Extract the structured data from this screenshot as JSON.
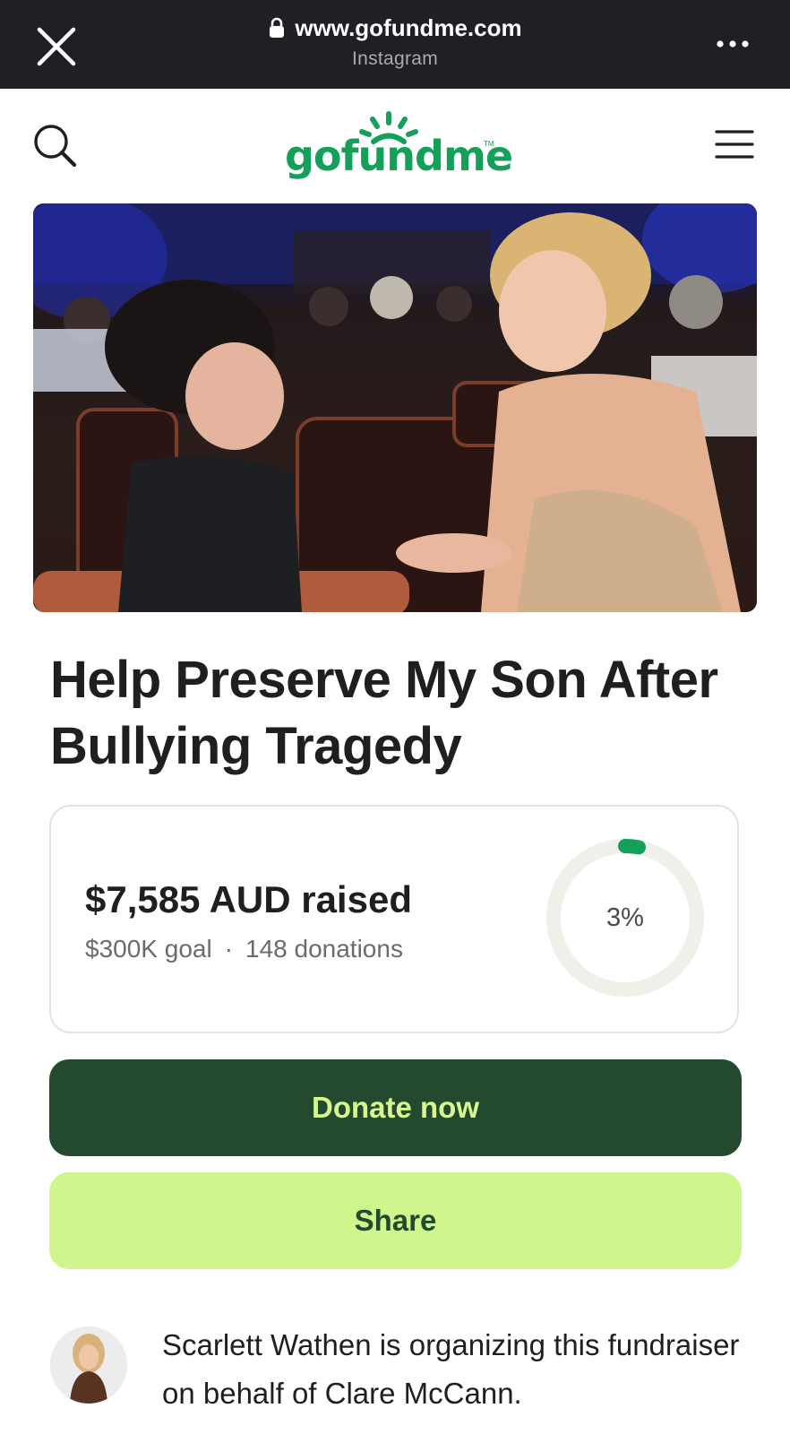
{
  "browser": {
    "url": "www.gofundme.com",
    "source": "Instagram"
  },
  "brand": {
    "logo_text": "gofundme",
    "trademark": "TM",
    "color": "#15a05a"
  },
  "icons": {
    "close": "close-icon",
    "lock": "lock-icon",
    "more": "more-icon",
    "search": "search-icon",
    "menu": "hamburger-menu-icon"
  },
  "campaign": {
    "title": "Help Preserve My Son After Bullying Tragedy",
    "raised": "$7,585 AUD raised",
    "goal": "$300K goal",
    "separator": "·",
    "donations": "148 donations",
    "percent_label": "3%",
    "progress_fraction": 0.03
  },
  "actions": {
    "donate_label": "Donate now",
    "share_label": "Share"
  },
  "organizer": {
    "text": "Scarlett Wathen is organizing this fundraiser on behalf of Clare McCann."
  },
  "colors": {
    "browser_bar": "#1f2024",
    "donate_bg": "#234a2f",
    "donate_text": "#d6f88f",
    "share_bg": "#cff68d",
    "progress": "#15a05a",
    "ring_track": "#f1efe9"
  }
}
